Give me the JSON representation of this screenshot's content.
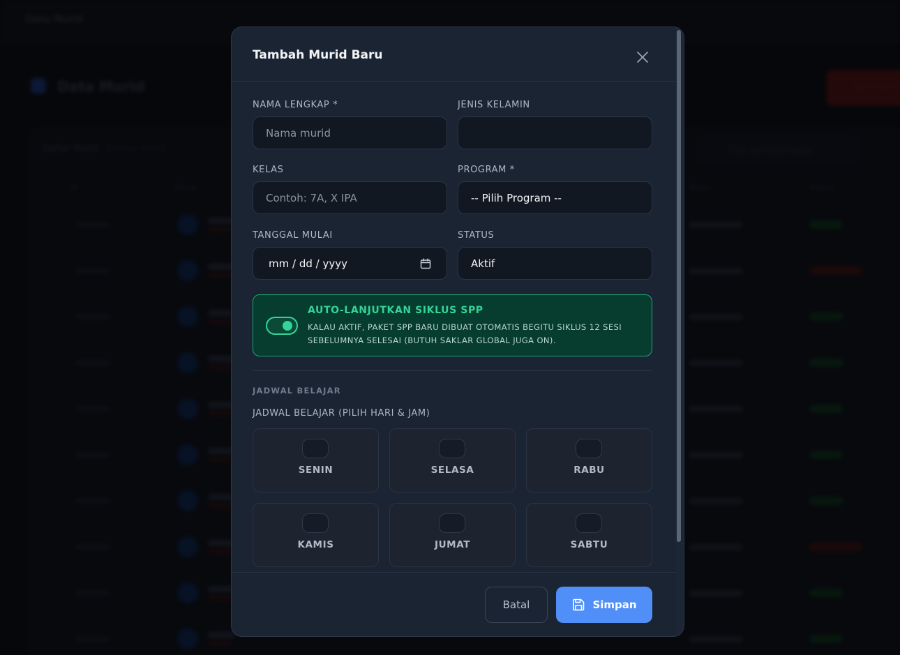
{
  "background": {
    "topbar_title": "Data Murid",
    "page_title": "Data Murid",
    "add_button": "Add Murid",
    "card_title": "Daftar Murid",
    "card_sub": "Semua murid",
    "search_placeholder": "Cari nama/pengajar",
    "table_headers": [
      "ID",
      "Murid",
      "Mulai",
      "Status"
    ]
  },
  "modal": {
    "title": "Tambah Murid Baru",
    "fields": {
      "nama_label": "NAMA LENGKAP *",
      "nama_placeholder": "Nama murid",
      "jenis_label": "JENIS KELAMIN",
      "jenis_value": "",
      "kelas_label": "KELAS",
      "kelas_placeholder": "Contoh: 7A, X IPA",
      "program_label": "PROGRAM *",
      "program_value": "-- Pilih Program --",
      "tanggal_label": "TANGGAL MULAI",
      "tanggal_placeholder": "mm / dd / yyyy",
      "status_label": "STATUS",
      "status_value": "Aktif"
    },
    "auto_spp": {
      "title": "AUTO-LANJUTKAN SIKLUS SPP",
      "description": "KALAU AKTIF, PAKET SPP BARU DIBUAT OTOMATIS BEGITU SIKLUS 12 SESI SEBELUMNYA SELESAI (BUTUH SAKLAR GLOBAL JUGA ON).",
      "enabled": true
    },
    "schedule": {
      "section_label": "JADWAL BELAJAR",
      "label": "JADWAL BELAJAR (PILIH HARI & JAM)",
      "days": [
        "SENIN",
        "SELASA",
        "RABU",
        "KAMIS",
        "JUMAT",
        "SABTU"
      ]
    },
    "footer": {
      "cancel_label": "Batal",
      "save_label": "Simpan"
    }
  },
  "colors": {
    "accent": "#4f8ff7",
    "success": "#34d399",
    "modal_bg": "#1b2433"
  }
}
